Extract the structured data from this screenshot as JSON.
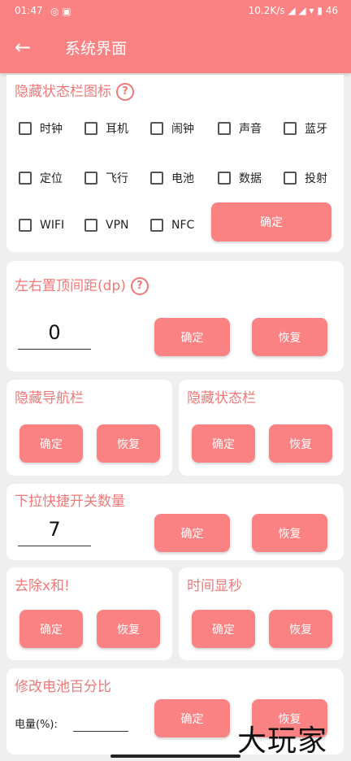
{
  "status_bar": {
    "time": "01:47",
    "net_speed": "10.2K/s",
    "battery": "46"
  },
  "toolbar": {
    "back_icon": "arrow-left-icon",
    "title": "系统界面"
  },
  "hide_icons": {
    "title": "隐藏状态栏图标",
    "items": [
      "时钟",
      "耳机",
      "闹钟",
      "声音",
      "蓝牙",
      "定位",
      "飞行",
      "电池",
      "数据",
      "投射",
      "WIFI",
      "VPN",
      "NFC"
    ],
    "confirm": "确定"
  },
  "top_spacing": {
    "title": "左右置顶间距(dp)",
    "value": "0",
    "confirm": "确定",
    "restore": "恢复"
  },
  "hide_nav": {
    "title": "隐藏导航栏",
    "confirm": "确定",
    "restore": "恢复"
  },
  "hide_status": {
    "title": "隐藏状态栏",
    "confirm": "确定",
    "restore": "恢复"
  },
  "quick_toggles": {
    "title": "下拉快捷开关数量",
    "value": "7",
    "confirm": "确定",
    "restore": "恢复"
  },
  "remove_x": {
    "title": "去除x和!",
    "confirm": "确定",
    "restore": "恢复"
  },
  "show_seconds": {
    "title": "时间显秒",
    "confirm": "确定",
    "restore": "恢复"
  },
  "battery_percent": {
    "title": "修改电池百分比",
    "label": "电量(%):",
    "value": "",
    "confirm": "确定",
    "restore": "恢复"
  },
  "watermark": "大玩家",
  "colors": {
    "accent": "#fa8282",
    "title_text": "#f07878",
    "background": "#efefef"
  }
}
